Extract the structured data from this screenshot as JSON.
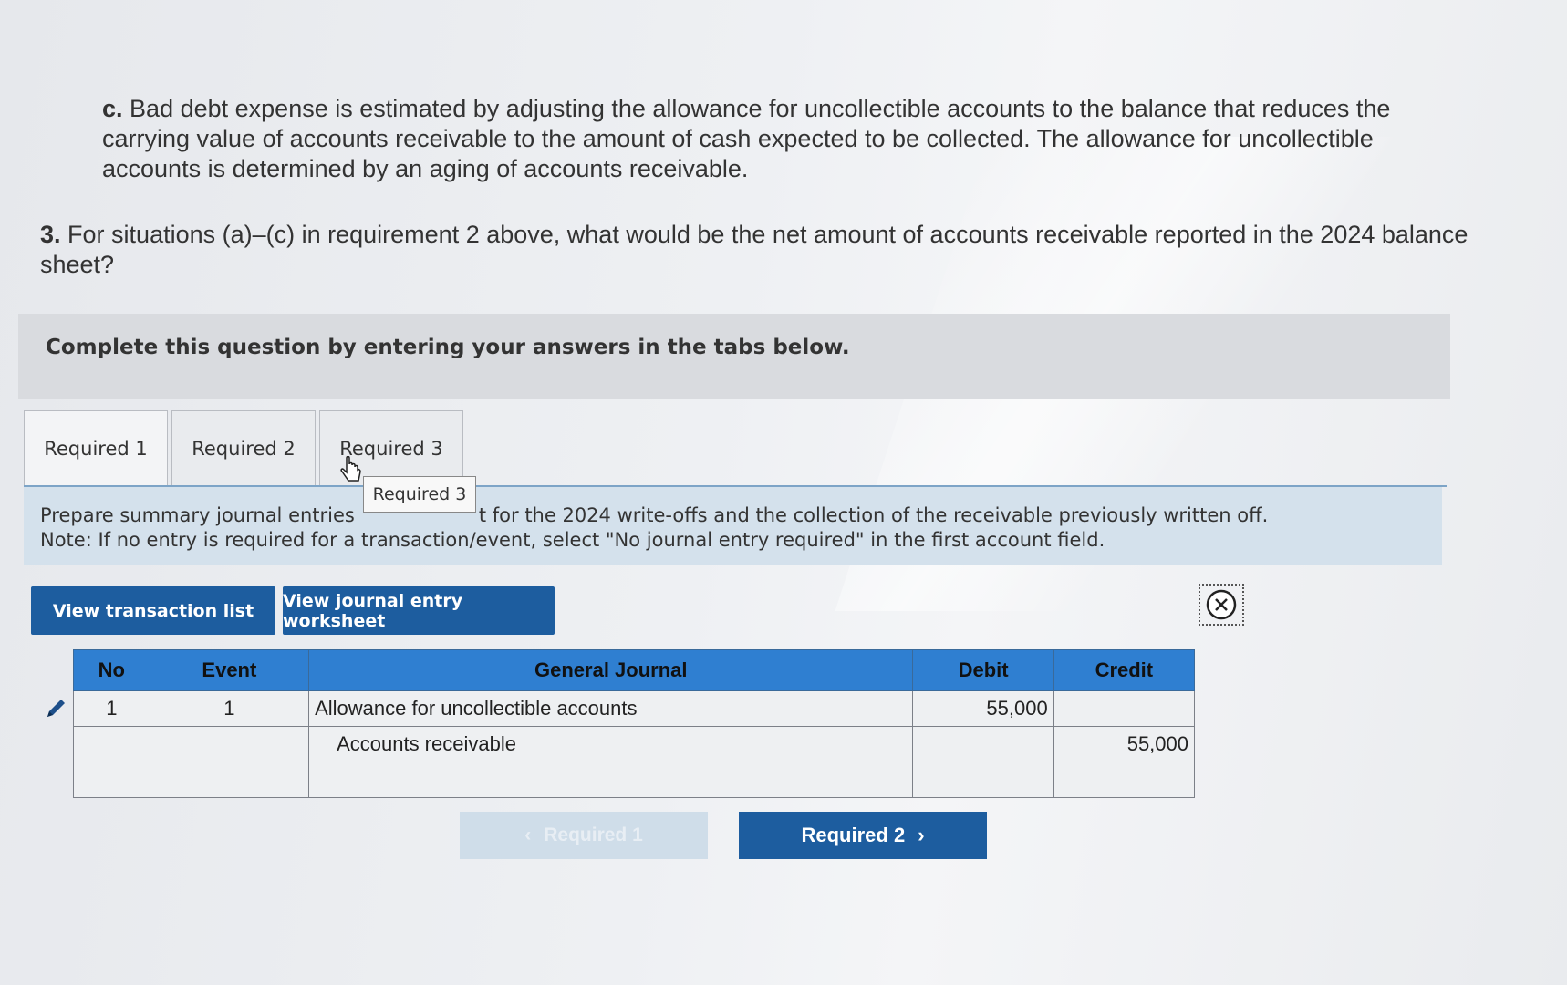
{
  "question": {
    "c_label": "c.",
    "c_text": "Bad debt expense is estimated by adjusting the allowance for uncollectible accounts to the balance that reduces the carrying value of accounts receivable to the amount of cash expected to be collected. The allowance for uncollectible accounts is determined by an aging of accounts receivable.",
    "q3_label": "3.",
    "q3_text": "For situations (a)–(c) in requirement 2 above, what would be the net amount of accounts receivable reported in the 2024 balance sheet?"
  },
  "instructions": "Complete this question by entering your answers in the tabs below.",
  "tabs": [
    {
      "label": "Required 1"
    },
    {
      "label": "Required 2"
    },
    {
      "label": "Required 3"
    }
  ],
  "tooltip": "Required 3",
  "prompt": {
    "line1_start": "Prepare summary journal entries",
    "line1_end": "t for the 2024 write-offs and the collection of the receivable previously written off.",
    "line2": "Note: If no entry is required for a transaction/event, select \"No journal entry required\" in the first account field."
  },
  "buttons": {
    "transaction_list": "View transaction list",
    "journal_worksheet": "View journal entry worksheet"
  },
  "journal": {
    "headers": {
      "no": "No",
      "event": "Event",
      "general_journal": "General Journal",
      "debit": "Debit",
      "credit": "Credit"
    },
    "rows": [
      {
        "no": "1",
        "event": "1",
        "account": "Allowance for uncollectible accounts",
        "debit": "55,000",
        "credit": ""
      },
      {
        "no": "",
        "event": "",
        "account": "Accounts receivable",
        "debit": "",
        "credit": "55,000"
      },
      {
        "no": "",
        "event": "",
        "account": "",
        "debit": "",
        "credit": ""
      }
    ]
  },
  "nav": {
    "prev_label": "Required 1",
    "next_label": "Required 2"
  },
  "icons": {
    "edit": "pencil-icon",
    "close": "close-circle-icon",
    "prev": "chevron-left-icon",
    "next": "chevron-right-icon",
    "cursor": "hand-cursor-icon"
  },
  "colors": {
    "primary_button": "#1d5d9f",
    "table_header": "#2f7fd1",
    "prompt_panel": "#d4e1ec"
  }
}
